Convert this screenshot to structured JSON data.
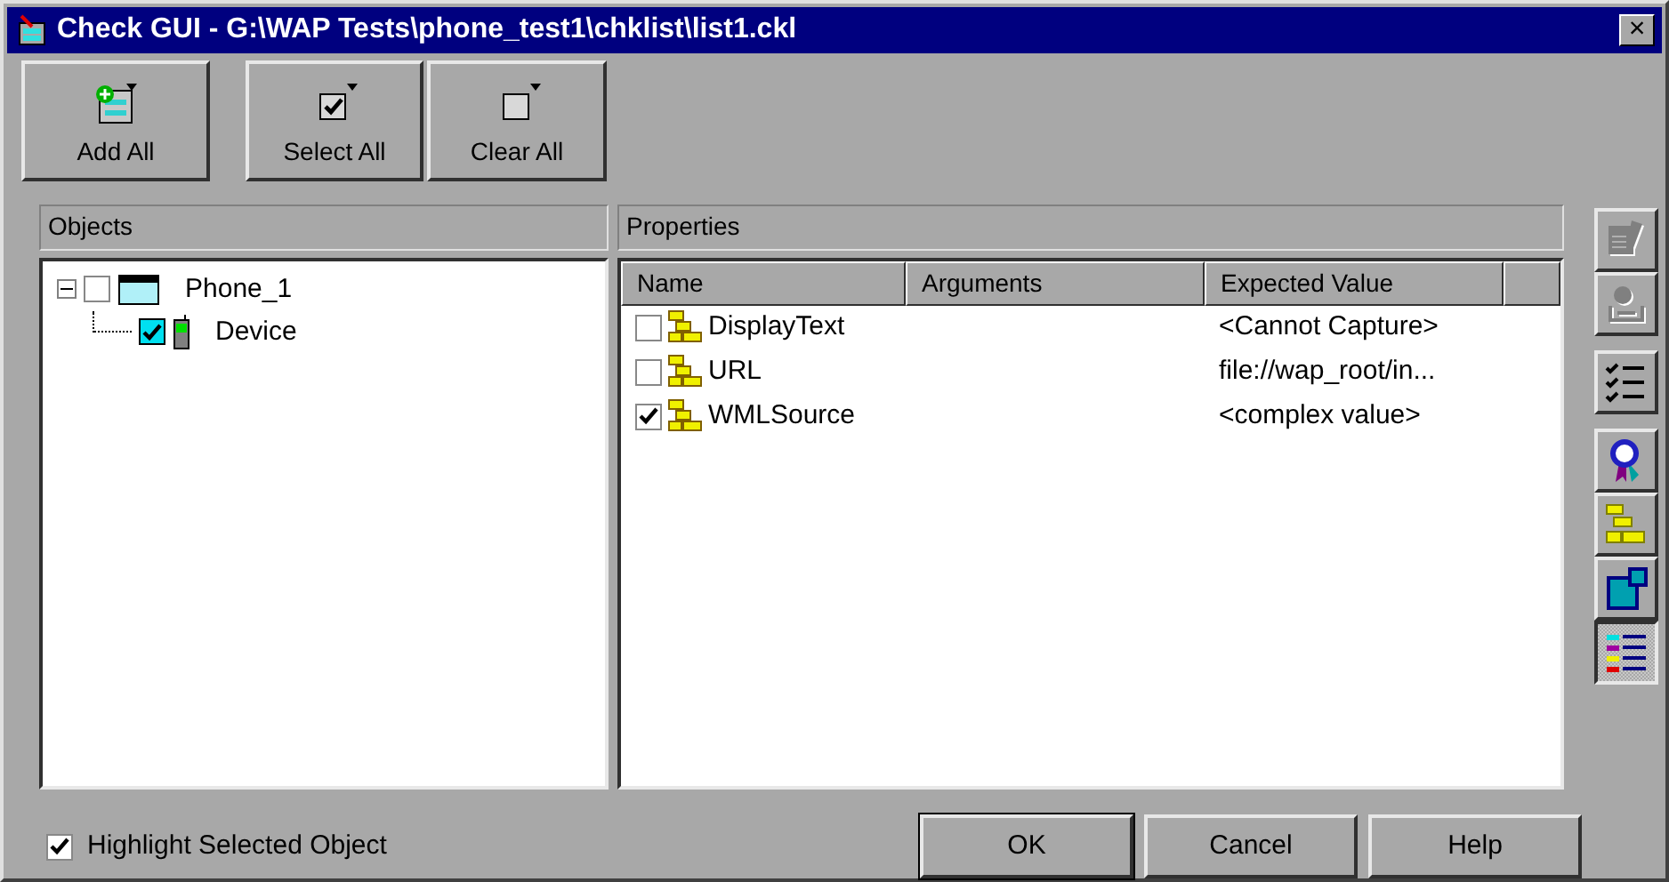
{
  "window": {
    "title": "Check GUI - G:\\WAP Tests\\phone_test1\\chklist\\list1.ckl",
    "close": "×"
  },
  "toolbar": [
    {
      "label": "Add All"
    },
    {
      "label": "Select All"
    },
    {
      "label": "Clear All"
    }
  ],
  "objects": {
    "header": "Objects",
    "tree": [
      {
        "label": "Phone_1",
        "expanded": true,
        "checked": false,
        "selected": false,
        "children": [
          {
            "label": "Device",
            "checked": true,
            "selected": true
          }
        ]
      }
    ]
  },
  "properties": {
    "header": "Properties",
    "columns": [
      "Name",
      "Arguments",
      "Expected Value"
    ],
    "rows": [
      {
        "name": "DisplayText",
        "expected": "<Cannot Capture>",
        "checked": false
      },
      {
        "name": "URL",
        "expected": "file://wap_root/in...",
        "checked": false
      },
      {
        "name": "WMLSource",
        "expected": "<complex value>",
        "checked": true
      }
    ]
  },
  "side_tools": [
    {
      "disabled": true,
      "selected": false
    },
    {
      "disabled": true,
      "selected": false
    },
    {
      "disabled": false,
      "selected": false
    },
    {
      "disabled": false,
      "selected": false
    },
    {
      "disabled": false,
      "selected": false
    },
    {
      "disabled": false,
      "selected": false
    },
    {
      "disabled": false,
      "selected": true
    }
  ],
  "highlight_option": {
    "label": "Highlight Selected Object",
    "checked": true
  },
  "buttons": [
    {
      "label": "OK",
      "default": true
    },
    {
      "label": "Cancel",
      "default": false
    },
    {
      "label": "Help",
      "default": false
    }
  ]
}
